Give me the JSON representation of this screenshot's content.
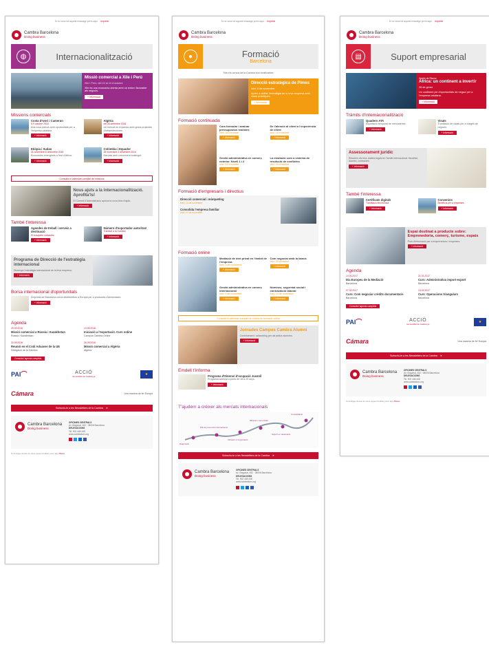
{
  "common": {
    "top_text": "Si no veus bé aquest missatge prem aquí",
    "top_link": "Imprimir",
    "logo_line1": "Cambra Barcelona",
    "logo_line2": "Doing business",
    "redbar_text": "Subscriu-te a les Newsletters de la Cambra",
    "footer_title": "OFICINES CENTRALS",
    "footer_addr": "Av. Diagonal, 452 · 08006 Barcelona",
    "footer_title2": "DELEGACIONS",
    "footer_phone": "Tel. 902 448 448",
    "footer_web": "www.cambrabcn.org",
    "legal": "Si desitges deixar de rebre aquest butlletí prem aquí",
    "legal_link": "Baixa",
    "logo_pai": "PAI",
    "logo_accio": "ACCIÓ",
    "logo_accio_sub": "Generalitat de Catalunya",
    "logo_camara": "Cámara",
    "logo_eu_text": "Una manera de fer Europa"
  },
  "col1": {
    "banner_title": "Internacionalització",
    "hero_title": "Missió comercial a Xile i Perú",
    "hero_date": "Xile i Perú, del 10 al 14 d'octubre",
    "hero_text": "Xile és una economia oberta amb un entorn favorable als negocis.",
    "hero_button": "+ Informació",
    "section1": "Missions comercials",
    "missions": [
      {
        "title": "Costa d'Ivori i Camerun",
        "date": "5-9 octubre 2016",
        "text": "Dos nous països amb oportunitats per a l'empresa catalana.",
        "button": "+ Informació"
      },
      {
        "title": "Algèria",
        "date": "del 26 setembre 2016",
        "text": "Un mercat en expansió amb grans projectes d'infraestructures.",
        "button": "+ Informació"
      },
      {
        "title": "Etiòpia i Sudan",
        "date": "31 novembre-5 desembre 2016",
        "text": "Economies emergents a l'est d'Àfrica.",
        "button": "+ Informació"
      },
      {
        "title": "Colòmbia i Equador",
        "date": "28 novembre-2 desembre 2016",
        "text": "Mercats amb creixement sostingut.",
        "button": "+ Informació"
      }
    ],
    "calendar_button": "Consulta el calendari complet de missions",
    "grey_title": "Nous ajuts a la internacionalització. Aprofita'ls!",
    "grey_text": "El Consell d'Administració aprova la nova línia d'ajuts.",
    "grey_button": "+ Informació",
    "section2": "També t'interessa",
    "also": [
      {
        "title": "Agendes de treball i serveis a destinació",
        "date": "Et busquem contactes",
        "text": "Organitzem la teva agenda de reunions.",
        "button": "+ Informació"
      },
      {
        "title": "Número d'exportador autoritzat",
        "date": "Tramita'l a la Cambra",
        "text": "Facilita les teves exportacions.",
        "button": "+ Informació"
      }
    ],
    "grey2_title": "Programa de Direcció de l'estratègia internacional",
    "grey2_text": "Dissenya l'estratègia internacional de la teva empresa.",
    "grey2_button": "+ Informació",
    "section3": "Borsa internacional d'oportunitats",
    "borsa_text": "Empresa de Barcelona cerca distribuïdors a Europa per a productes d'alimentació.",
    "borsa_button": "+ Informació",
    "section4": "Agenda",
    "agenda": [
      {
        "date": "20.09.2016",
        "title": "Missió comercial a Rússia i Kazakhstan",
        "place": "Rússia i Kazakhstan"
      },
      {
        "date": "13.09.2016",
        "title": "Iniciació a l'exportació. Curs online",
        "place": "Campus Cambra Online"
      },
      {
        "date": "22.09.2016",
        "title": "Reunió en el Codi Aduaner de la UE",
        "place": "Delegació de la Cambra"
      },
      {
        "date": "26.09.2016",
        "title": "Missió comercial a Algèria",
        "place": "Algèria"
      }
    ],
    "agenda_button": "Consulta l'agenda completa"
  },
  "col2": {
    "banner_title": "Formació",
    "banner_sub": "Barcelona",
    "intro": "Tots els cursos de la Cambra són bonificables",
    "hero_title": "Direcció estratègica de Pimes",
    "hero_date": "Inici: 5 de novembre",
    "hero_text": "Aprèn a definir l'estratègia de la teva empresa amb eines pràctiques.",
    "hero_button": "+ Informació",
    "section1": "Formació continuada",
    "courses": [
      {
        "title": "Com formular i avaluar pressupostos realistes",
        "date": "Inici: 14 d'octubre",
        "button": "+ Informació"
      },
      {
        "title": "De l'atenció al client a l'experiència de client",
        "date": "Inici: 18 d'octubre",
        "button": "+ Informació"
      },
      {
        "title": "Gestió administrativa en comerç exterior. Nivell 1 i 2",
        "date": "Inici: 19 d'octubre",
        "button": "+ Informació"
      },
      {
        "title": "La mediació com a sistema de resolució de conflictes",
        "date": "Inici: 25 d'octubre",
        "button": "+ Informació"
      }
    ],
    "section2": "Formació d'empresaris i directius",
    "directius": [
      {
        "title": "Direcció comercial i màrqueting",
        "date": "Inici: 13 de novembre"
      },
      {
        "title": "Consolida l'empresa familiar",
        "date": "Inici: 17 de novembre"
      }
    ],
    "section3": "Formació online",
    "online": [
      {
        "title": "Mediació de dret privat en l'àmbit de l'empresa",
        "date": "Inici: 1 de novembre",
        "button": "+ Informació"
      },
      {
        "title": "Com negociar amb la banca",
        "date": "Inici: 25 d'octubre",
        "button": "+ Informació"
      },
      {
        "title": "Gestió administrativa en comerç internacional",
        "date": "Inici: 3 de novembre",
        "button": "+ Informació"
      },
      {
        "title": "Nòmines, seguretat social i contractació laboral",
        "date": "Inici: 14 de novembre",
        "button": "+ Informació"
      }
    ],
    "online_button": "Consulta el calendari complet de cursos de formació online",
    "grey_title": "Jornades Campus Cambra Alumni",
    "grey_text": "Coneixement i networking per als antics alumnes.",
    "grey_button": "+ Informació",
    "section4": "Emdell t'informa",
    "emdell_title": "Programa d'Itinerari d'ocupació Juvenil",
    "emdell_text": "Programa adreçat a joves de 16 a 29 anys.",
    "emdell_button": "+ Informació",
    "step_title": "T'ajudem a créixer als mercats internacionals",
    "steps": [
      "Diagnòstic",
      "Pla de promoció internacional",
      "Iniciació a l'exportació",
      "Missions comercials",
      "Suport en destinació",
      "Consolidació"
    ]
  },
  "col3": {
    "banner_title": "Suport empresarial",
    "hero_kicker": "Gestió de Riscos",
    "hero_title": "Àfrica: un continent a invertir",
    "hero_date": "28 de gener",
    "hero_text": "Un continent ple d'oportunitats de negoci per a l'empresa catalana.",
    "hero_button": "+ Informació",
    "section1": "Tràmits d'internacionalització",
    "tramits": [
      {
        "title": "Quadern ATA",
        "text": "Importació temporal de mercaderies.",
        "button": "+ Informació"
      },
      {
        "title": "Visats",
        "text": "Tramitació de visats per a viatges de negocis.",
        "button": "+ Informació"
      }
    ],
    "section2": "Assessorament jurídic",
    "jur_text": "Resolem els teus dubtes legals en l'àmbit internacional: fiscalitat, duanes, contractes.",
    "jur_button": "+ Informació",
    "section3": "També t'interessa",
    "also": [
      {
        "title": "Certificats digitals",
        "date": "Tramitació electrònica",
        "button": "+ Informació"
      },
      {
        "title": "Convenios",
        "date": "Beneficis per a empreses",
        "button": "+ Informació"
      }
    ],
    "grey_title": "Espai destinat a producte sobre: Emprenedoria, comerç, turisme, espais",
    "grey_text": "Punt d'informació per a emprenedors i empreses.",
    "grey_button": "+ Informació",
    "section4": "Agenda",
    "agenda": [
      {
        "date": "14.01.2017",
        "title": "Dia Europeu de la Mediació",
        "place": "Barcelona"
      },
      {
        "date": "21.01.2017",
        "title": "Curs: Administrativa import-export",
        "place": "Barcelona"
      },
      {
        "date": "07.02.2017",
        "title": "Curs: Com negociar crèdits documentaris",
        "place": "Barcelona"
      },
      {
        "date": "13.02.2017",
        "title": "Curs: Operacions triangulars",
        "place": "Barcelona"
      }
    ],
    "agenda_button": "Consulta l'agenda completa"
  }
}
